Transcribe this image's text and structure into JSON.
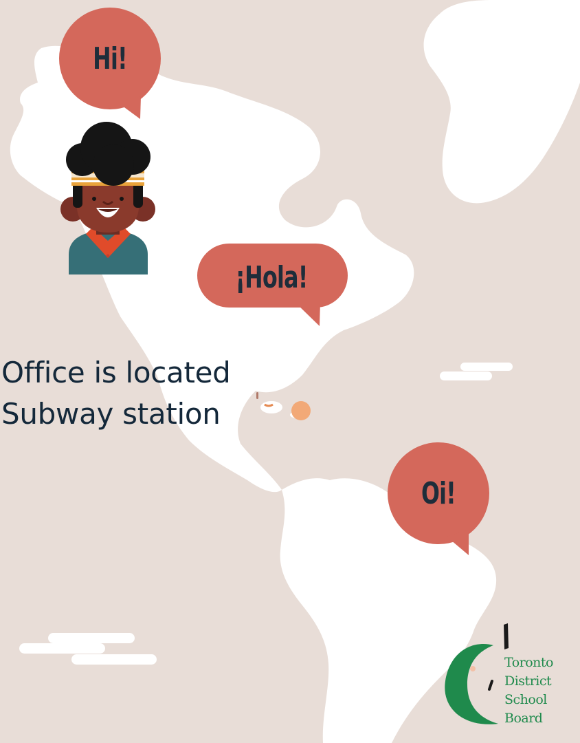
{
  "speech_bubbles": {
    "english": "Hi!",
    "spanish": "¡Hola!",
    "portuguese": "Oi!"
  },
  "caption": {
    "line1": "Office is located",
    "line2": "Subway station"
  },
  "logo": {
    "line1": "Toronto",
    "line2": "District",
    "line3": "School",
    "line4": "Board"
  },
  "colors": {
    "background": "#e8ddd7",
    "land": "#ffffff",
    "bubble": "#d4685b",
    "text_dark": "#14283a",
    "logo_green": "#1f8a4c"
  }
}
